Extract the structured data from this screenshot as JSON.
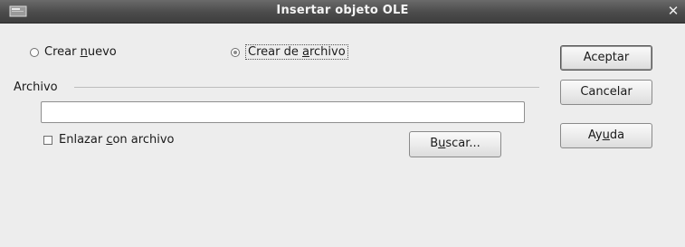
{
  "window": {
    "title": "Insertar objeto OLE",
    "icon": "app-window-icon",
    "close_label": "✕"
  },
  "options": {
    "create_new": {
      "pre": "Crear ",
      "mnemonic": "n",
      "post": "uevo",
      "selected": false
    },
    "create_from_file": {
      "pre": "Crear de ",
      "mnemonic": "a",
      "post": "rchivo",
      "selected": true
    }
  },
  "file_section": {
    "label": "Archivo",
    "path_value": "",
    "link_checkbox": {
      "pre": "Enlazar ",
      "mnemonic": "c",
      "post": "on archivo",
      "checked": false
    },
    "browse_button": {
      "pre": "B",
      "mnemonic": "u",
      "post": "scar..."
    }
  },
  "buttons": {
    "ok": "Aceptar",
    "cancel": "Cancelar",
    "help": {
      "pre": "Ay",
      "mnemonic": "u",
      "post": "da"
    }
  },
  "colors": {
    "titlebar": "#4b4b4b",
    "dialog_background": "#ededed",
    "title_text": "#f4f4f4"
  }
}
